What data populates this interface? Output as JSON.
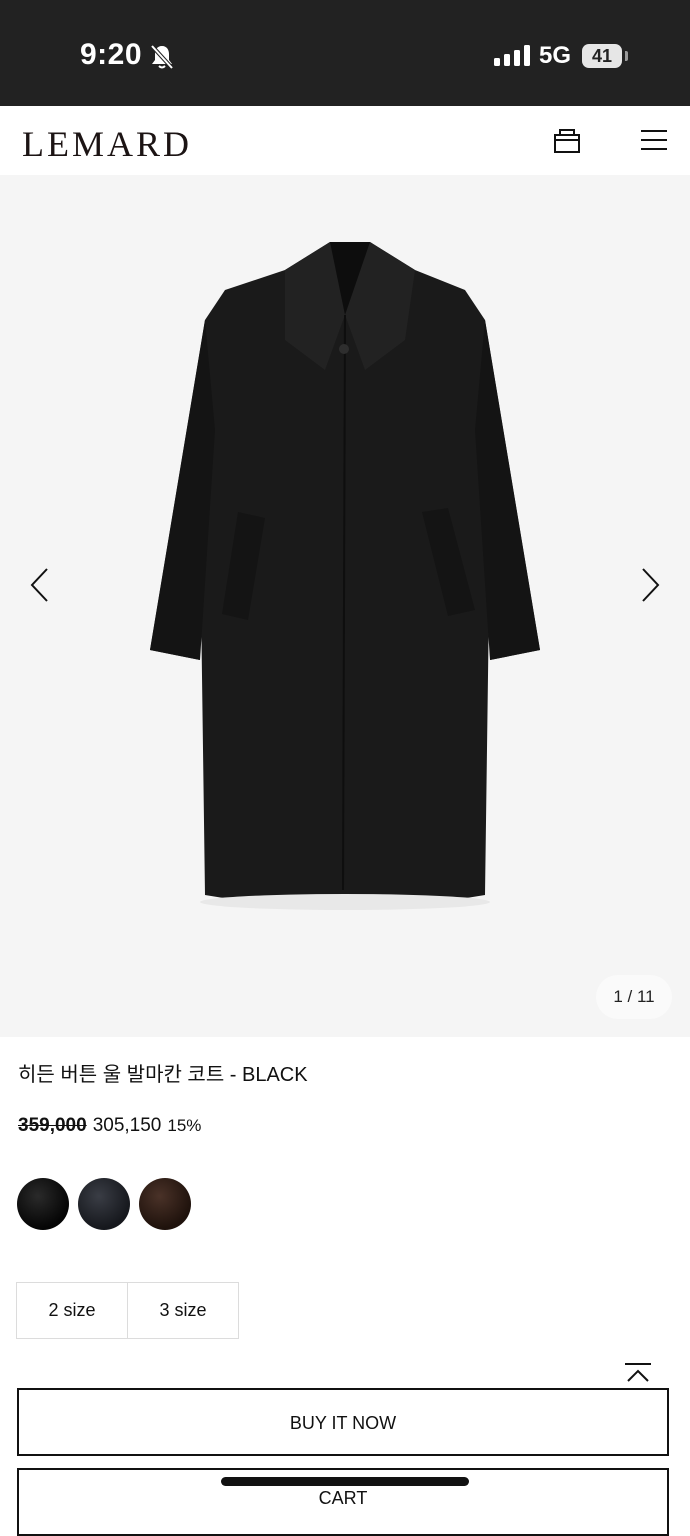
{
  "status_bar": {
    "time": "9:20",
    "network": "5G",
    "battery": "41",
    "icons": [
      "bell-muted-icon",
      "signal-icon",
      "battery-icon"
    ]
  },
  "header": {
    "logo": "LEMARD",
    "icons": [
      "shopping-bag-icon",
      "hamburger-menu-icon"
    ]
  },
  "gallery": {
    "counter": "1 / 11",
    "icons": [
      "chevron-left-icon",
      "chevron-right-icon"
    ]
  },
  "product": {
    "title": "히든 버튼 울 발마칸 코트 - BLACK",
    "price_original": "359,000",
    "price_sale": "305,150",
    "discount": "15%"
  },
  "colors": [
    {
      "name": "black",
      "hex": "#0a0a0a"
    },
    {
      "name": "navy",
      "hex": "#1e2026"
    },
    {
      "name": "brown",
      "hex": "#2a1810"
    }
  ],
  "sizes": [
    "2 size",
    "3 size"
  ],
  "actions": {
    "buy_now": "BUY IT NOW",
    "cart": "CART"
  }
}
